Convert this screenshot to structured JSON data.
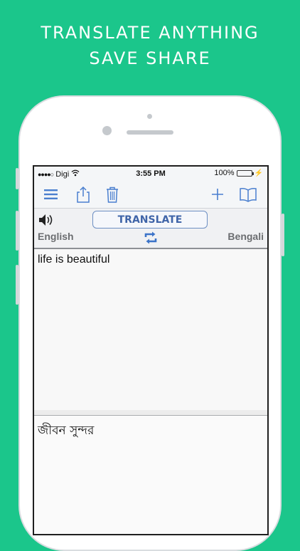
{
  "promo": {
    "line1": "TRANSLATE ANYTHING",
    "line2": "SAVE SHARE"
  },
  "statusbar": {
    "signal_dots": "●●●●○",
    "carrier": "Digi",
    "time": "3:55 PM",
    "battery": "100%"
  },
  "toolbar": {
    "icons": [
      "menu-icon",
      "share-icon",
      "trash-icon",
      "plus-icon",
      "book-icon"
    ]
  },
  "controls": {
    "translate_label": "TRANSLATE",
    "source_language": "English",
    "target_language": "Bengali"
  },
  "input": {
    "text": "life is beautiful"
  },
  "output": {
    "text": "জীবন সুন্দর"
  },
  "colors": {
    "background": "#1bc68b",
    "accent": "#4a7fcf",
    "button_text": "#3f64a8"
  }
}
